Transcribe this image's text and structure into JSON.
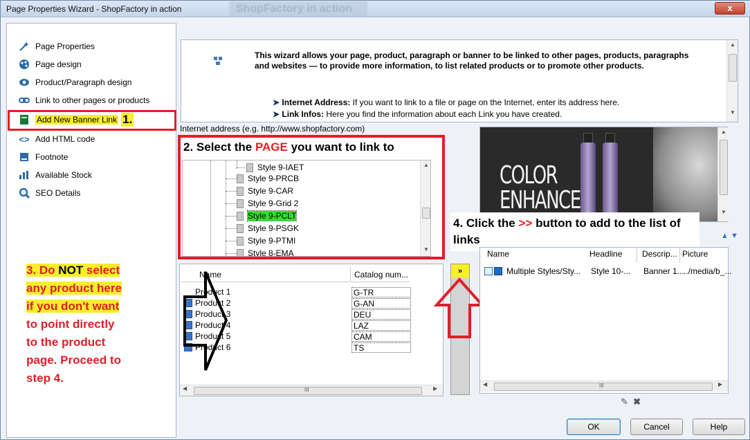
{
  "window": {
    "title": "Page Properties Wizard - ShopFactory in action",
    "background_title": "ShopFactory in action",
    "close_label": "x"
  },
  "sidebar": {
    "items": [
      {
        "label": "Page Properties",
        "icon": "wizard-icon"
      },
      {
        "label": "Page design",
        "icon": "palette-icon"
      },
      {
        "label": "Product/Paragraph design",
        "icon": "eye-icon"
      },
      {
        "label": "Link to other pages or products",
        "icon": "link-icon"
      },
      {
        "label": "Add New Banner Link",
        "icon": "banner-icon"
      },
      {
        "label": "Add HTML code",
        "icon": "code-icon"
      },
      {
        "label": "Footnote",
        "icon": "footnote-icon"
      },
      {
        "label": "Available Stock",
        "icon": "stock-icon"
      },
      {
        "label": "SEO Details",
        "icon": "search-icon"
      }
    ],
    "step1_label": "1."
  },
  "info": {
    "main": "This wizard allows your page, product, paragraph or banner to be linked to other pages, products, paragraphs and websites — to provide more information, to list related products or to promote other products.",
    "bullet1_title": "Internet Address:",
    "bullet1_text": " If you want to link to a file or page on the Internet, enter its address here.",
    "bullet2_title": "Link Infos:",
    "bullet2_text": " Here you find the information about each Link you have created."
  },
  "internet_label": "Internet address (e.g. http://www.shopfactory.com)",
  "step2": {
    "prefix": "2. Select the ",
    "highlight": "PAGE",
    "suffix": " you want to link to"
  },
  "tree_items": [
    "Style 9-IAET",
    "Style 9-PRCB",
    "Style 9-CAR",
    "Style 9-Grid 2",
    "Style 9-PCLT",
    "Style 9-PSGK",
    "Style 9-PTMI",
    "Style 8-EMA"
  ],
  "products": {
    "col_name": "Name",
    "col_catalog": "Catalog num...",
    "rows": [
      {
        "name": "Product 1",
        "catalog": "G-TR"
      },
      {
        "name": "Product 2",
        "catalog": "G-AN"
      },
      {
        "name": "Product 3",
        "catalog": "DEU"
      },
      {
        "name": "Product 4",
        "catalog": "LAZ"
      },
      {
        "name": "Product 5",
        "catalog": "CAM"
      },
      {
        "name": "Product 6",
        "catalog": "TS"
      }
    ]
  },
  "step3": {
    "l1a": "3. Do ",
    "l1b": "NOT",
    "l1c": " select",
    "l2": "any product here",
    "l3": "if you don't want",
    "l4": "to point directly",
    "l5": "to the product",
    "l6": "page. Proceed to",
    "l7": "step 4."
  },
  "step4": {
    "prefix": "4. Click the ",
    "highlight": ">>",
    "suffix": " button to add to the list of links"
  },
  "add_button_label": "»",
  "banner": {
    "line1": "COLOR",
    "line2": "ENHANCE"
  },
  "links": {
    "col_name": "Name",
    "col_headline": "Headline",
    "col_desc": "Descrip...",
    "col_picture": "Picture",
    "row": {
      "name": "Multiple Styles/Sty...",
      "headline": "Style 10-...",
      "desc": "Banner 1...",
      "picture": "../media/b_..."
    }
  },
  "scroll_grip": "III",
  "buttons": {
    "ok": "OK",
    "cancel": "Cancel",
    "help": "Help"
  },
  "colors": {
    "accent_red": "#e01e2a",
    "highlight_yellow": "#f8ee2a",
    "selected_green": "#2fe02f"
  }
}
